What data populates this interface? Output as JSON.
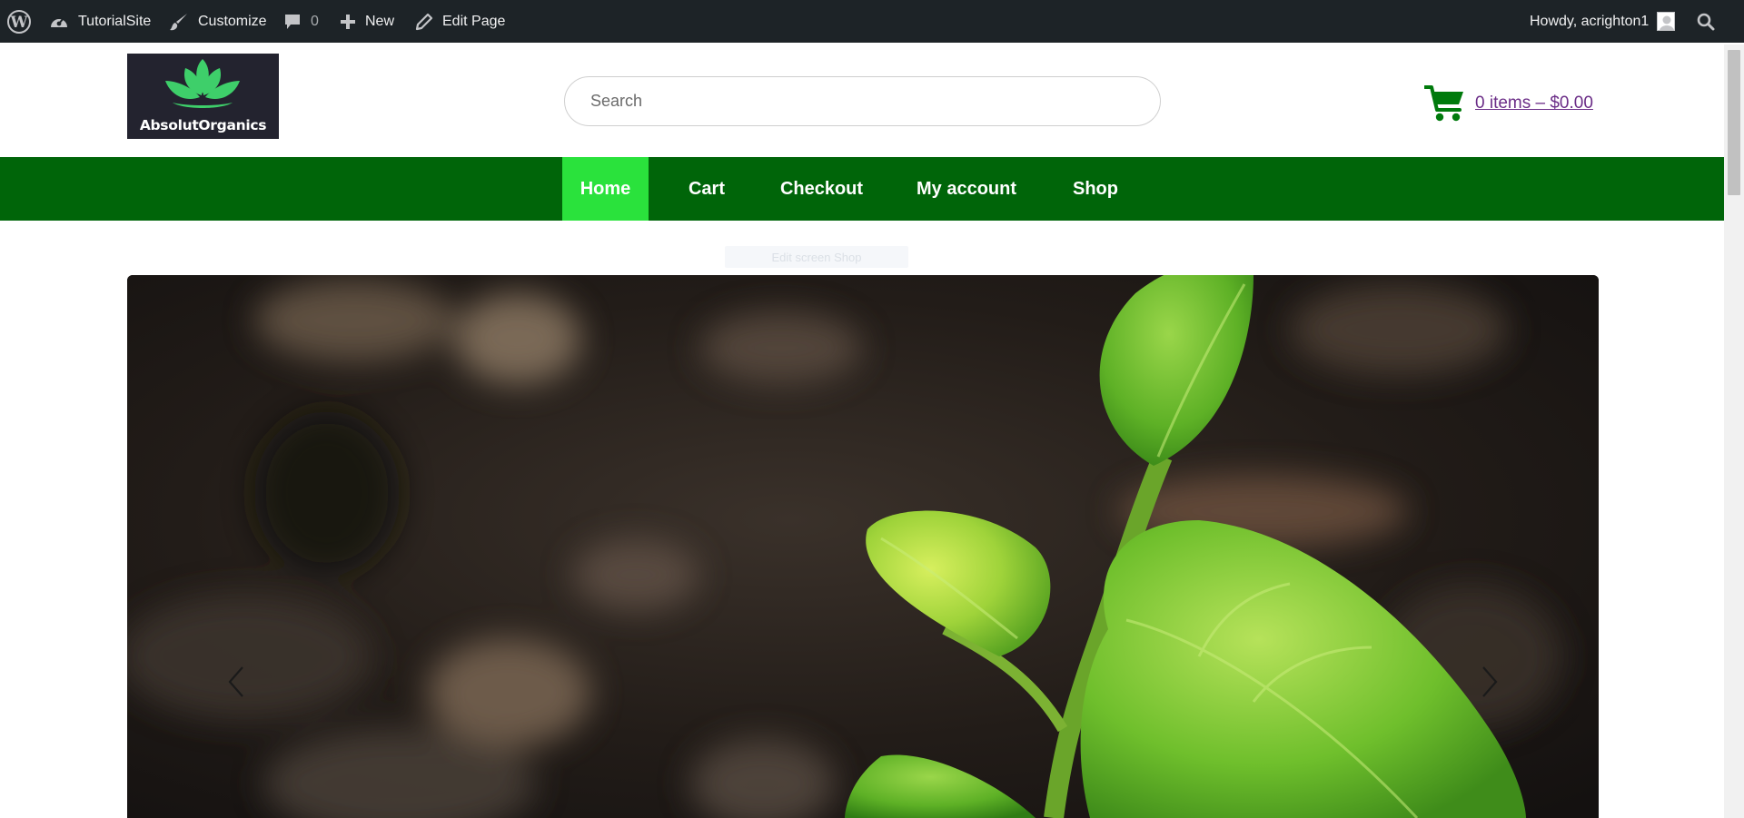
{
  "admin_bar": {
    "site_name": "TutorialSite",
    "customize": "Customize",
    "comments_count": "0",
    "new": "New",
    "edit_page": "Edit Page",
    "greeting": "Howdy, acrighton1"
  },
  "header": {
    "logo_text": "AbsolutOrganics",
    "search_placeholder": "Search",
    "cart_label": "0 items – $0.00"
  },
  "nav": {
    "items": [
      {
        "label": "Home",
        "active": true
      },
      {
        "label": "Cart"
      },
      {
        "label": "Checkout"
      },
      {
        "label": "My account"
      },
      {
        "label": "Shop"
      }
    ]
  },
  "faint_label": "Edit screen Shop",
  "colors": {
    "admin_bar": "#1d2327",
    "nav_bg": "#006509",
    "nav_active": "#2ae23c",
    "cart_icon": "#007a0c",
    "cart_link": "#6b2d87"
  },
  "icons": {
    "wordpress": "wordpress-logo-icon",
    "dashboard": "dashboard-icon",
    "customize": "paintbrush-icon",
    "comments": "comment-bubble-icon",
    "new": "plus-icon",
    "edit": "pencil-icon",
    "search": "search-icon",
    "cart": "shopping-cart-icon",
    "prev": "chevron-left-icon",
    "next": "chevron-right-icon"
  }
}
